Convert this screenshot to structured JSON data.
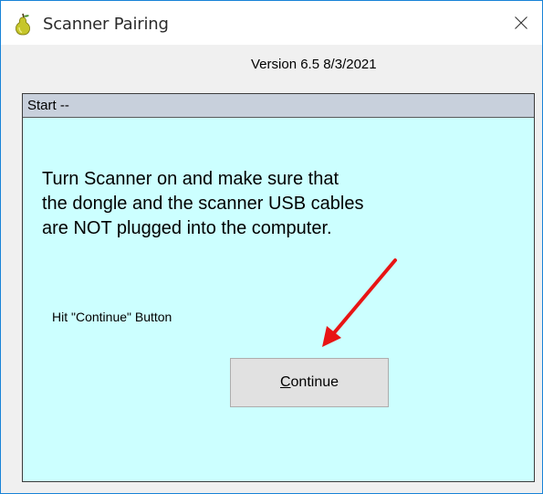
{
  "window": {
    "title": "Scanner Pairing",
    "icon": "pear-icon",
    "close_icon": "close-icon"
  },
  "version_text": "Version 6.5 8/3/2021",
  "panel": {
    "header": "Start --",
    "background_color": "#ccffff",
    "instructions": [
      "Turn Scanner on and make sure that",
      "the dongle and the scanner USB cables",
      "are NOT plugged into the computer."
    ],
    "hint": "Hit \"Continue\" Button"
  },
  "continue_button": {
    "mnemonic": "C",
    "rest": "ontinue"
  },
  "annotation": {
    "arrow_color": "#e81414"
  }
}
